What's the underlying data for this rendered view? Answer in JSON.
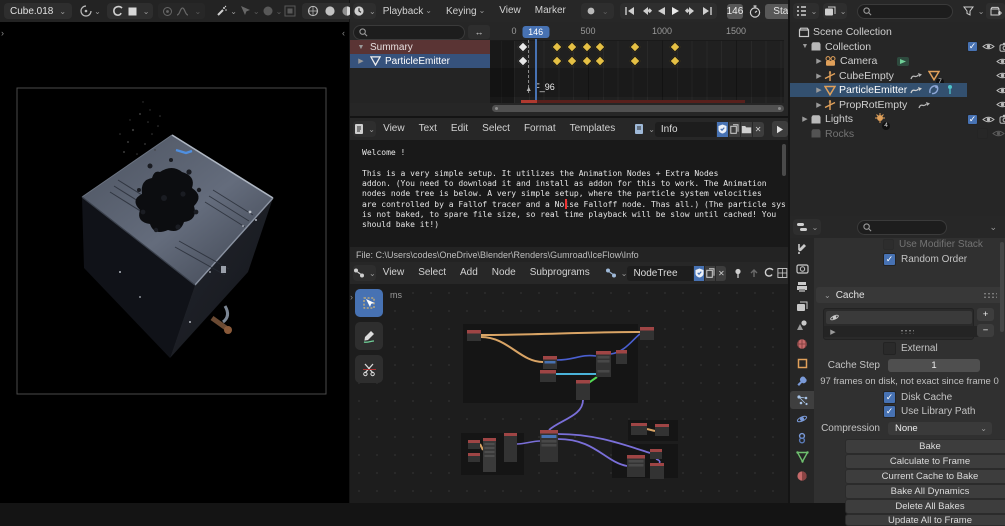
{
  "icons": {
    "chevron_down": "⌄",
    "tri_right": "▶",
    "tri_down": "▼",
    "tri_up": "▲",
    "arrows_h": "↔",
    "close": "✕",
    "check": "✓",
    "plus": "+",
    "minus": "−",
    "panel_open_right": "›",
    "panel_open_left": "‹"
  },
  "viewport": {
    "object_selector": "Cube.018"
  },
  "timeline": {
    "menus": [
      {
        "label": "Playback"
      },
      {
        "label": "Keying"
      },
      {
        "label": "View"
      },
      {
        "label": "Marker"
      }
    ],
    "current_frame": "146",
    "start_field_label": "Start",
    "ruler": {
      "ticks": [
        {
          "frame": 0,
          "label": "0"
        },
        {
          "frame": 500,
          "label": "500"
        },
        {
          "frame": 1000,
          "label": "1000"
        },
        {
          "frame": 1500,
          "label": "1500"
        }
      ]
    },
    "channels": [
      {
        "name": "Summary"
      },
      {
        "name": "ParticleEmitter"
      }
    ],
    "marker": {
      "label": "F_96",
      "frame": 96
    },
    "keyframes": {
      "white_frames": [
        60
      ],
      "yellow_frames": [
        290,
        390,
        490,
        580,
        820,
        1085
      ]
    }
  },
  "text_editor": {
    "menus": [
      {
        "label": "View"
      },
      {
        "label": "Text"
      },
      {
        "label": "Edit"
      },
      {
        "label": "Select"
      },
      {
        "label": "Format"
      },
      {
        "label": "Templates"
      }
    ],
    "datablock_name": "Info",
    "lines": [
      "Welcome !",
      "",
      "This is a very simple setup. It utilizes the Animation Nodes + Extra Nodes",
      "addon. (You need to download it and install as addon for this to work. The Animation",
      "nodes node tree is below. A very simple setup, where the particle system velocities",
      "are controlled by a Fallof tracer and a Noise Falloff node. Thas all.) (The particle sys",
      "is not baked, to spare file size, so real time playback will be slow until cached! You",
      "should bake it!)"
    ],
    "file_path": "File: C:\\Users\\codes\\OneDrive\\Blender\\Renders\\Gumroad\\IceFlow\\Info"
  },
  "node_editor": {
    "menus": [
      {
        "label": "View"
      },
      {
        "label": "Select"
      },
      {
        "label": "Add"
      },
      {
        "label": "Node"
      },
      {
        "label": "Subprograms"
      }
    ],
    "datablock_name": "NodeTree",
    "perf_label": "ms"
  },
  "outliner": {
    "root_label": "Scene Collection",
    "rows": [
      {
        "label": "Collection"
      },
      {
        "label": "Camera"
      },
      {
        "label": "CubeEmpty",
        "badge_count": "7"
      },
      {
        "label": "ParticleEmitter"
      },
      {
        "label": "PropRotEmpty"
      },
      {
        "label": "Lights",
        "badge_count": "4"
      },
      {
        "label": "Rocks"
      }
    ]
  },
  "properties": {
    "modifier_stack_label": "Use Modifier Stack",
    "random_order_label": "Random Order",
    "cache_panel_label": "Cache",
    "external_label": "External",
    "cache_step_label": "Cache Step",
    "cache_step_value": "1",
    "disk_status": "97 frames on disk, not exact since frame 0",
    "disk_cache_label": "Disk Cache",
    "use_library_path_label": "Use Library Path",
    "compression_label": "Compression",
    "compression_value": "None",
    "action_buttons": [
      {
        "label": "Bake"
      },
      {
        "label": "Calculate to Frame"
      },
      {
        "label": "Current Cache to Bake"
      },
      {
        "label": "Bake All Dynamics"
      },
      {
        "label": "Delete All Bakes"
      },
      {
        "label": "Update All to Frame"
      }
    ]
  }
}
